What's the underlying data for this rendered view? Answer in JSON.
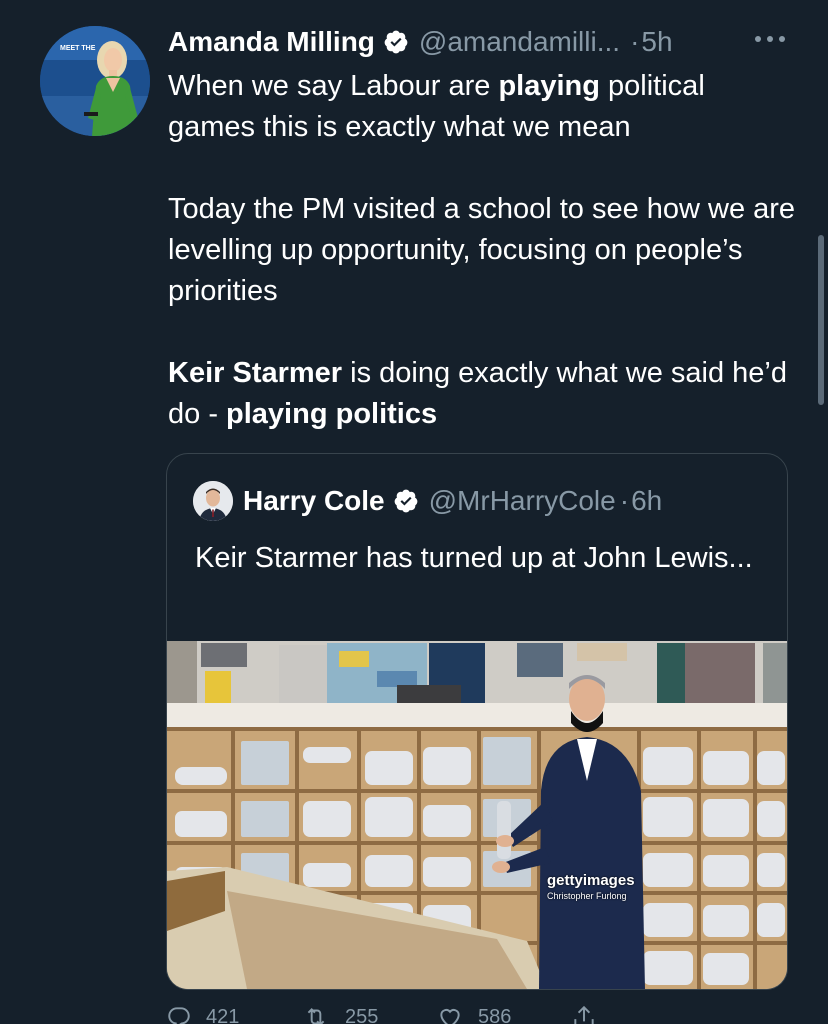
{
  "tweet": {
    "author": {
      "display_name": "Amanda Milling",
      "handle": "@amandamilli...",
      "separator": "·",
      "time": "5h",
      "avatar_backdrop_text": "MEET THE"
    },
    "body": {
      "p1_pre": "When we say Labour are ",
      "p1_bold": "playing",
      "p1_post": " political games this is exactly what we mean",
      "p2": "Today the PM visited a school to see how we are levelling up opportunity, focusing on people’s priorities",
      "p3_bold1": "Keir Starmer",
      "p3_mid": " is doing exactly what we said he’d do - ",
      "p3_bold2": "playing politics"
    },
    "quote": {
      "display_name": "Harry Cole",
      "handle": "@MrHarryCole",
      "separator": "·",
      "time": "6h",
      "text": "Keir Starmer has turned up at John Lewis...",
      "image": {
        "watermark": "gettyimages",
        "credit": "Christopher Furlong"
      }
    },
    "actions": {
      "reply_count": "421",
      "retweet_count": "255",
      "like_count": "586"
    }
  },
  "colors": {
    "background": "#15202b",
    "secondary_text": "#8899a6",
    "border": "#38444d",
    "verified": "#ffffff"
  },
  "icons": [
    "verified-badge-icon",
    "more-icon",
    "reply-icon",
    "retweet-icon",
    "like-icon",
    "share-icon"
  ]
}
